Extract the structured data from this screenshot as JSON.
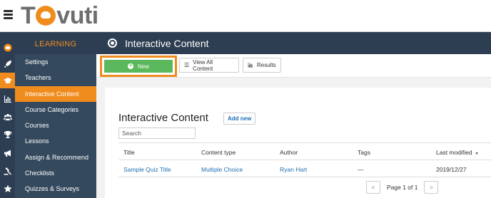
{
  "app": {
    "logo_text_1": "T",
    "logo_text_2": "vuti"
  },
  "sidebar": {
    "title": "LEARNING",
    "items": [
      {
        "label": "Settings"
      },
      {
        "label": "Teachers"
      },
      {
        "label": "Interactive Content",
        "active": true
      },
      {
        "label": "Course Categories"
      },
      {
        "label": "Courses"
      },
      {
        "label": "Lessons"
      },
      {
        "label": "Assign & Recommend"
      },
      {
        "label": "Checklists"
      },
      {
        "label": "Quizzes & Surveys"
      }
    ]
  },
  "rail_icons": [
    "tovuti-icon",
    "rocket-icon",
    "graduation-cap-icon",
    "bar-chart-icon",
    "users-icon",
    "trophy-icon",
    "megaphone-icon",
    "gavel-icon",
    "star-icon"
  ],
  "header": {
    "title": "Interactive Content"
  },
  "toolbar": {
    "new_label": "New",
    "view_all_label": "View All Content",
    "results_label": "Results"
  },
  "content": {
    "title": "Interactive Content",
    "add_new_label": "Add new",
    "search_placeholder": "Search",
    "columns": {
      "title": "Title",
      "content_type": "Content type",
      "author": "Author",
      "tags": "Tags",
      "last_modified": "Last modified"
    },
    "rows": [
      {
        "title": "Sample Quiz Title",
        "content_type": "Multiple Choice",
        "author": "Ryan Hart",
        "tags": "—",
        "last_modified": "2019/12/27"
      }
    ],
    "pagination": {
      "prev": "<",
      "text": "Page 1 of 1",
      "next": ">"
    }
  },
  "colors": {
    "accent": "#f08c1d",
    "nav_dark": "#2d3e52",
    "nav": "#34495e",
    "success": "#5cb85c",
    "link": "#1f6fb2"
  }
}
